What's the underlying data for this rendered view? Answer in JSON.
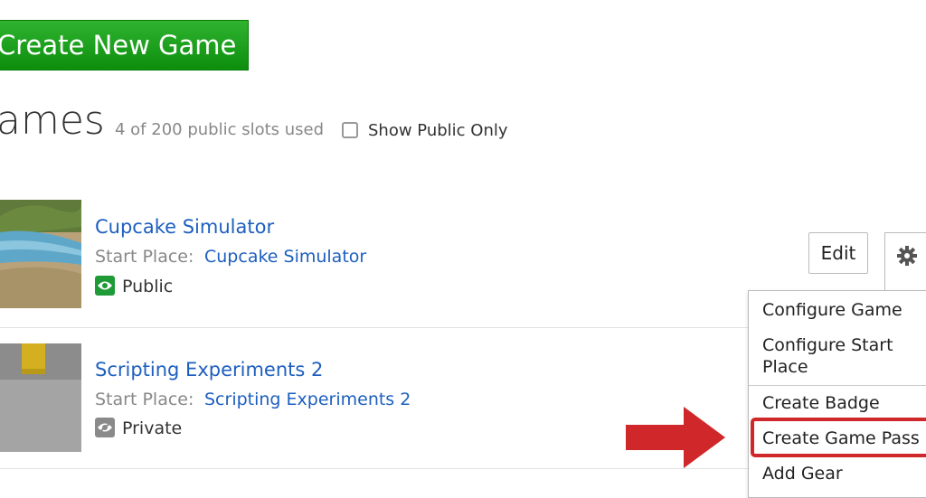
{
  "header": {
    "create_button": "Create New Game",
    "title": "ames",
    "slots": "4 of 200 public slots used",
    "filter_label": "Show Public Only"
  },
  "games": [
    {
      "title": "Cupcake Simulator",
      "start_place_label": "Start Place:",
      "start_place": "Cupcake Simulator",
      "status": "Public"
    },
    {
      "title": "Scripting Experiments 2",
      "start_place_label": "Start Place:",
      "start_place": "Scripting Experiments 2",
      "status": "Private"
    }
  ],
  "actions": {
    "edit_label": "Edit",
    "menu_items": [
      "Configure Game",
      "Configure Start",
      "Place",
      "Create Badge",
      "Create Game Pass",
      "Add Gear"
    ]
  },
  "colors": {
    "create_button": "#1fa31f",
    "link": "#1d5fbf",
    "public_badge": "#1e9a37",
    "private_badge": "#8a8a8a",
    "highlight": "#d0282a"
  },
  "icons": [
    "gear-icon",
    "chevron-down-icon",
    "eye-icon",
    "eye-slash-icon",
    "arrow-right-icon"
  ]
}
